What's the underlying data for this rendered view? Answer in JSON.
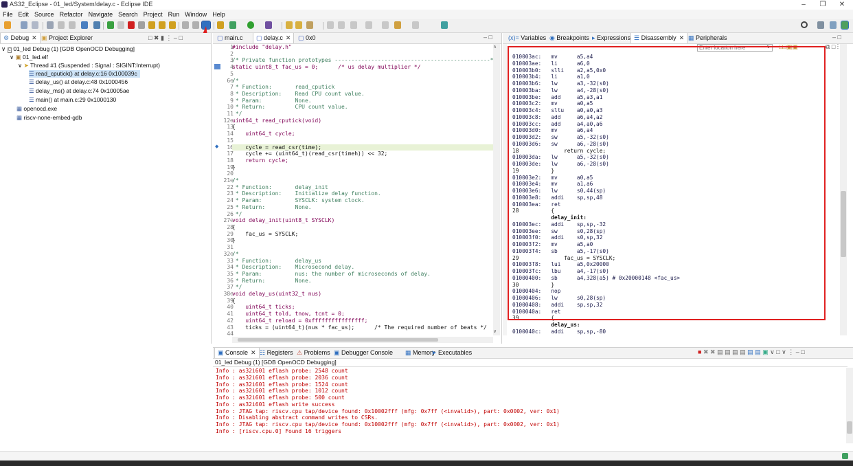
{
  "window": {
    "title": "AS32_Eclipse - 01_led/System/delay.c - Eclipse IDE"
  },
  "menu": [
    "File",
    "Edit",
    "Source",
    "Refactor",
    "Navigate",
    "Search",
    "Project",
    "Run",
    "Window",
    "Help"
  ],
  "debug_view": {
    "tabs": [
      {
        "label": "Debug"
      },
      {
        "label": "Project Explorer"
      }
    ],
    "tree": [
      {
        "label": "01_led Debug (1) [GDB OpenOCD Debugging]",
        "indent": 0
      },
      {
        "label": "01_led.elf",
        "indent": 1
      },
      {
        "label": "Thread #1 (Suspended : Signal : SIGINT:Interrupt)",
        "indent": 2
      },
      {
        "label": "read_cputick() at delay.c:16 0x100039c",
        "indent": 3,
        "selected": true
      },
      {
        "label": "delay_us() at delay.c:48 0x1000456",
        "indent": 3
      },
      {
        "label": "delay_ms() at delay.c:74 0x10005ae",
        "indent": 3
      },
      {
        "label": "main() at main.c:29 0x1000130",
        "indent": 3
      },
      {
        "label": "openocd.exe",
        "indent": 1
      },
      {
        "label": "riscv-none-embed-gdb",
        "indent": 1
      }
    ]
  },
  "editor": {
    "tabs": [
      {
        "label": "main.c"
      },
      {
        "label": "delay.c"
      },
      {
        "label": "0x0"
      }
    ],
    "lines": [
      {
        "n": "1",
        "t": "#include \"delay.h\""
      },
      {
        "n": "2",
        "t": ""
      },
      {
        "n": "3",
        "t": "/* Private function prototypes -----------------------------------------------*/"
      },
      {
        "n": "4",
        "t": "static uint8_t fac_us = 0;      /* us delay multiplier */"
      },
      {
        "n": "5",
        "t": ""
      },
      {
        "n": "6⊖",
        "t": "/*"
      },
      {
        "n": "7",
        "t": " * Function:       read_cputick"
      },
      {
        "n": "8",
        "t": " * Description:    Read CPU count value."
      },
      {
        "n": "9",
        "t": " * Param:          None."
      },
      {
        "n": "10",
        "t": " * Return:         CPU count value."
      },
      {
        "n": "11",
        "t": " */"
      },
      {
        "n": "12⊖",
        "t": "uint64_t read_cputick(void)"
      },
      {
        "n": "13",
        "t": "{"
      },
      {
        "n": "14",
        "t": "    uint64_t cycle;"
      },
      {
        "n": "15",
        "t": ""
      },
      {
        "n": "16",
        "t": "    cycle = read_csr(time);"
      },
      {
        "n": "17",
        "t": "    cycle += (uint64_t)(read_csr(timeh)) << 32;"
      },
      {
        "n": "18",
        "t": "    return cycle;"
      },
      {
        "n": "19",
        "t": "}"
      },
      {
        "n": "20",
        "t": ""
      },
      {
        "n": "21⊖",
        "t": "/*"
      },
      {
        "n": "22",
        "t": " * Function:       delay_init"
      },
      {
        "n": "23",
        "t": " * Description:    Initialize delay function."
      },
      {
        "n": "24",
        "t": " * Param:          SYSCLK: system clock."
      },
      {
        "n": "25",
        "t": " * Return:         None."
      },
      {
        "n": "26",
        "t": " */"
      },
      {
        "n": "27⊖",
        "t": "void delay_init(uint8_t SYSCLK)"
      },
      {
        "n": "28",
        "t": "{"
      },
      {
        "n": "29",
        "t": "    fac_us = SYSCLK;"
      },
      {
        "n": "30",
        "t": "}"
      },
      {
        "n": "31",
        "t": ""
      },
      {
        "n": "32⊖",
        "t": "/*"
      },
      {
        "n": "33",
        "t": " * Function:       delay_us"
      },
      {
        "n": "34",
        "t": " * Description:    Microsecond delay."
      },
      {
        "n": "35",
        "t": " * Param:          nus: the number of microseconds of delay."
      },
      {
        "n": "36",
        "t": " * Return:         None."
      },
      {
        "n": "37",
        "t": " */"
      },
      {
        "n": "38⊖",
        "t": "void delay_us(uint32_t nus)"
      },
      {
        "n": "39",
        "t": "{"
      },
      {
        "n": "40",
        "t": "    uint64_t ticks;"
      },
      {
        "n": "41",
        "t": "    uint64_t told, tnow, tcnt = 0;"
      },
      {
        "n": "42",
        "t": "    uint64_t reload = 0xffffffffffffffff;"
      },
      {
        "n": "43",
        "t": "    ticks = (uint64_t)(nus * fac_us);      /* The required number of beats */"
      },
      {
        "n": "44",
        "t": ""
      }
    ]
  },
  "right_view": {
    "tabs": [
      {
        "label": "Variables"
      },
      {
        "label": "Breakpoints"
      },
      {
        "label": "Expressions"
      },
      {
        "label": "Disassembly"
      },
      {
        "label": "Peripherals"
      }
    ],
    "location_placeholder": "Enter location here",
    "asm": [
      "010003ac:   mv      a5,a4",
      "010003ae:   li      a6,0",
      "010003b0:   slli    a2,a5,0x0",
      "010003b4:   li      a1,0",
      "010003b6:   lw      a3,-32(s0)",
      "010003ba:   lw      a4,-28(s0)",
      "010003be:   add     a5,a3,a1",
      "010003c2:   mv      a0,a5",
      "010003c4:   sltu    a0,a0,a3",
      "010003c8:   add     a6,a4,a2",
      "010003cc:   add     a4,a0,a6",
      "010003d0:   mv      a6,a4",
      "010003d2:   sw      a5,-32(s0)",
      "010003d6:   sw      a6,-28(s0)",
      "18              return cycle;",
      "010003da:   lw      a5,-32(s0)",
      "010003de:   lw      a6,-28(s0)",
      "19          }",
      "010003e2:   mv      a0,a5",
      "010003e4:   mv      a1,a6",
      "010003e6:   lw      s0,44(sp)",
      "010003e8:   addi    sp,sp,48",
      "010003ea:   ret",
      "28          {",
      "            delay_init:",
      "010003ec:   addi    sp,sp,-32",
      "010003ee:   sw      s0,28(sp)",
      "010003f0:   addi    s0,sp,32",
      "010003f2:   mv      a5,a0",
      "010003f4:   sb      a5,-17(s0)",
      "29              fac_us = SYSCLK;",
      "010003f8:   lui     a5,0x20000",
      "010003fc:   lbu     a4,-17(s0)",
      "01000400:   sb      a4,328(a5) # 0x20000148 <fac_us>",
      "30          }",
      "01000404:   nop",
      "01000406:   lw      s0,28(sp)",
      "01000408:   addi    sp,sp,32",
      "0100040a:   ret",
      "39          {",
      "            delay_us:",
      "0100040c:   addi    sp,sp,-80"
    ]
  },
  "bottom_view": {
    "tabs": [
      {
        "label": "Console"
      },
      {
        "label": "Registers"
      },
      {
        "label": "Problems"
      },
      {
        "label": "Debugger Console"
      },
      {
        "label": "Memory"
      },
      {
        "label": "Executables"
      }
    ],
    "session": "01_led Debug (1) [GDB OpenOCD Debugging]",
    "lines": [
      "Info : as32i601 eflash probe: 2548 count",
      "Info : as32i601 eflash probe: 2036 count",
      "Info : as32i601 eflash probe: 1524 count",
      "Info : as32i601 eflash probe: 1012 count",
      "Info : as32i601 eflash probe: 500 count",
      "Info : as32i601 eflash write success",
      "Info : JTAG tap: riscv.cpu tap/device found: 0x10002fff (mfg: 0x7ff (<invalid>), part: 0x0002, ver: 0x1)",
      "Info : Disabling abstract command writes to CSRs.",
      "Info : JTAG tap: riscv.cpu tap/device found: 0x10002fff (mfg: 0x7ff (<invalid>), part: 0x0002, ver: 0x1)",
      "Info : [riscv.cpu.0] Found 16 triggers"
    ]
  },
  "colors": {
    "accent": "#3399ff",
    "console_text": "#c00000",
    "highlight_box": "#e02020"
  }
}
